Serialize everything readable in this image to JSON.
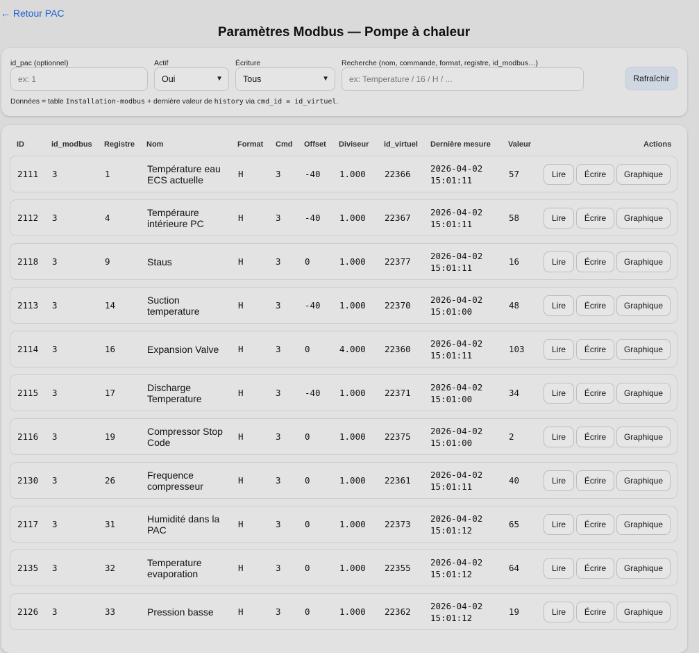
{
  "nav": {
    "back_label": "← Retour PAC"
  },
  "title": "Paramètres Modbus — Pompe à chaleur",
  "filters": {
    "id_pac_label": "id_pac (optionnel)",
    "id_pac_placeholder": "ex: 1",
    "actif_label": "Actif",
    "actif_value": "Oui",
    "ecriture_label": "Écriture",
    "ecriture_value": "Tous",
    "search_label": "Recherche (nom, commande, format, registre, id_modbus…)",
    "search_placeholder": "ex: Temperature / 16 / H / ...",
    "refresh_label": "Rafraîchir",
    "note_prefix": "Données = table ",
    "note_table": "Installation-modbus",
    "note_mid": " + dernière valeur de ",
    "note_history": "history",
    "note_via": " via ",
    "note_code": "cmd_id = id_virtuel",
    "note_end": "."
  },
  "table": {
    "headers": {
      "id": "ID",
      "id_modbus": "id_modbus",
      "registre": "Registre",
      "nom": "Nom",
      "format": "Format",
      "cmd": "Cmd",
      "offset": "Offset",
      "diviseur": "Diviseur",
      "id_virtuel": "id_virtuel",
      "derniere_mesure": "Dernière mesure",
      "valeur": "Valeur",
      "actions": "Actions"
    },
    "action_labels": {
      "read": "Lire",
      "write": "Écrire",
      "chart": "Graphique"
    },
    "rows": [
      {
        "id": "2111",
        "id_modbus": "3",
        "registre": "1",
        "nom": "Température eau ECS actuelle",
        "format": "H",
        "cmd": "3",
        "offset": "-40",
        "diviseur": "1.000",
        "id_virtuel": "22366",
        "date": "2026-04-02",
        "time": "15:01:11",
        "valeur": "57"
      },
      {
        "id": "2112",
        "id_modbus": "3",
        "registre": "4",
        "nom": "Tempéraure intérieure PC",
        "format": "H",
        "cmd": "3",
        "offset": "-40",
        "diviseur": "1.000",
        "id_virtuel": "22367",
        "date": "2026-04-02",
        "time": "15:01:11",
        "valeur": "58"
      },
      {
        "id": "2118",
        "id_modbus": "3",
        "registre": "9",
        "nom": "Staus",
        "format": "H",
        "cmd": "3",
        "offset": "0",
        "diviseur": "1.000",
        "id_virtuel": "22377",
        "date": "2026-04-02",
        "time": "15:01:11",
        "valeur": "16"
      },
      {
        "id": "2113",
        "id_modbus": "3",
        "registre": "14",
        "nom": "Suction temperature",
        "format": "H",
        "cmd": "3",
        "offset": "-40",
        "diviseur": "1.000",
        "id_virtuel": "22370",
        "date": "2026-04-02",
        "time": "15:01:00",
        "valeur": "48"
      },
      {
        "id": "2114",
        "id_modbus": "3",
        "registre": "16",
        "nom": "Expansion Valve",
        "format": "H",
        "cmd": "3",
        "offset": "0",
        "diviseur": "4.000",
        "id_virtuel": "22360",
        "date": "2026-04-02",
        "time": "15:01:11",
        "valeur": "103"
      },
      {
        "id": "2115",
        "id_modbus": "3",
        "registre": "17",
        "nom": "Discharge Temperature",
        "format": "H",
        "cmd": "3",
        "offset": "-40",
        "diviseur": "1.000",
        "id_virtuel": "22371",
        "date": "2026-04-02",
        "time": "15:01:00",
        "valeur": "34"
      },
      {
        "id": "2116",
        "id_modbus": "3",
        "registre": "19",
        "nom": "Compressor Stop Code",
        "format": "H",
        "cmd": "3",
        "offset": "0",
        "diviseur": "1.000",
        "id_virtuel": "22375",
        "date": "2026-04-02",
        "time": "15:01:00",
        "valeur": "2"
      },
      {
        "id": "2130",
        "id_modbus": "3",
        "registre": "26",
        "nom": "Frequence compresseur",
        "format": "H",
        "cmd": "3",
        "offset": "0",
        "diviseur": "1.000",
        "id_virtuel": "22361",
        "date": "2026-04-02",
        "time": "15:01:11",
        "valeur": "40"
      },
      {
        "id": "2117",
        "id_modbus": "3",
        "registre": "31",
        "nom": "Humidité dans la PAC",
        "format": "H",
        "cmd": "3",
        "offset": "0",
        "diviseur": "1.000",
        "id_virtuel": "22373",
        "date": "2026-04-02",
        "time": "15:01:12",
        "valeur": "65"
      },
      {
        "id": "2135",
        "id_modbus": "3",
        "registre": "32",
        "nom": "Temperature evaporation",
        "format": "H",
        "cmd": "3",
        "offset": "0",
        "diviseur": "1.000",
        "id_virtuel": "22355",
        "date": "2026-04-02",
        "time": "15:01:12",
        "valeur": "64"
      },
      {
        "id": "2126",
        "id_modbus": "3",
        "registre": "33",
        "nom": "Pression basse",
        "format": "H",
        "cmd": "3",
        "offset": "0",
        "diviseur": "1.000",
        "id_virtuel": "22362",
        "date": "2026-04-02",
        "time": "15:01:12",
        "valeur": "19"
      }
    ]
  }
}
